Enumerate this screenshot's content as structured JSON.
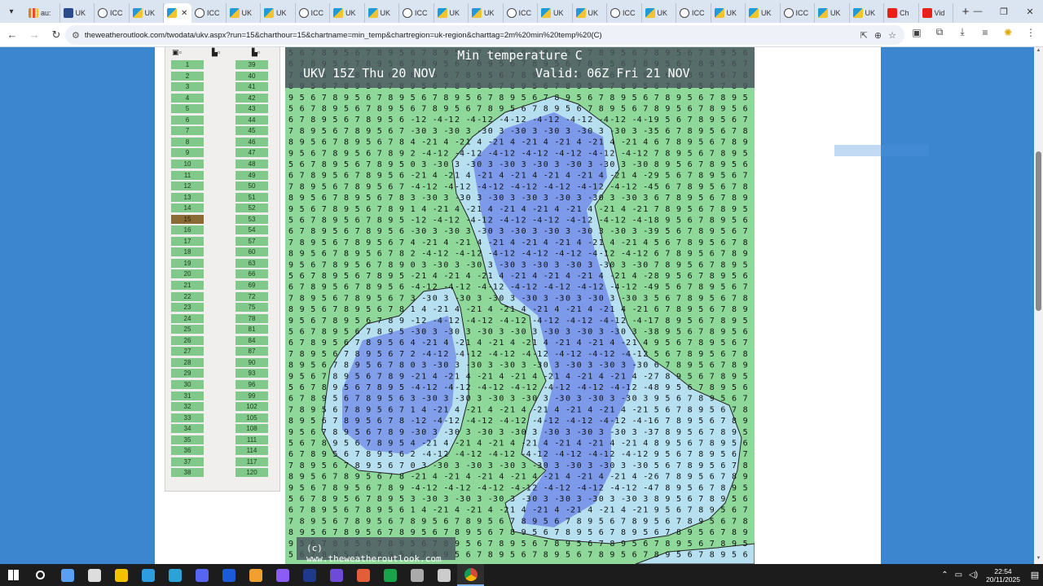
{
  "browser": {
    "tabs": [
      {
        "label": "au:",
        "icon": "bars-icon"
      },
      {
        "label": "UK",
        "icon": "flag-icon"
      },
      {
        "label": "ICC",
        "icon": "globe-icon"
      },
      {
        "label": "UK",
        "icon": "weather-icon"
      },
      {
        "label": "",
        "icon": "weather-icon",
        "active": true
      },
      {
        "label": "ICC",
        "icon": "globe-icon"
      },
      {
        "label": "UK",
        "icon": "weather-icon"
      },
      {
        "label": "UK",
        "icon": "weather-icon"
      },
      {
        "label": "ICC",
        "icon": "globe-icon"
      },
      {
        "label": "UK",
        "icon": "weather-icon"
      },
      {
        "label": "UK",
        "icon": "weather-icon"
      },
      {
        "label": "ICC",
        "icon": "globe-icon"
      },
      {
        "label": "UK",
        "icon": "weather-icon"
      },
      {
        "label": "UK",
        "icon": "weather-icon"
      },
      {
        "label": "ICC",
        "icon": "globe-icon"
      },
      {
        "label": "UK",
        "icon": "weather-icon"
      },
      {
        "label": "UK",
        "icon": "weather-icon"
      },
      {
        "label": "ICC",
        "icon": "globe-icon"
      },
      {
        "label": "UK",
        "icon": "weather-icon"
      },
      {
        "label": "ICC",
        "icon": "globe-icon"
      },
      {
        "label": "UK",
        "icon": "weather-icon"
      },
      {
        "label": "UK",
        "icon": "weather-icon"
      },
      {
        "label": "ICC",
        "icon": "globe-icon"
      },
      {
        "label": "UK",
        "icon": "weather-icon"
      },
      {
        "label": "UK",
        "icon": "weather-icon"
      },
      {
        "label": "Ch",
        "icon": "youtube-icon"
      },
      {
        "label": "Vid",
        "icon": "youtube-icon"
      }
    ],
    "url": "theweatheroutlook.com/twodata/ukv.aspx?run=15&charthour=15&chartname=min_temp&chartregion=uk-region&charttag=2m%20min%20temp%20(C)"
  },
  "hours": {
    "col1": [
      "1",
      "2",
      "3",
      "4",
      "5",
      "6",
      "7",
      "8",
      "9",
      "10",
      "11",
      "12",
      "13",
      "14",
      "15",
      "16",
      "17",
      "18",
      "19",
      "20",
      "21",
      "22",
      "23",
      "24",
      "25",
      "26",
      "27",
      "28",
      "29",
      "30",
      "31",
      "32",
      "33",
      "34",
      "35",
      "36",
      "37",
      "38"
    ],
    "col2": [
      "39",
      "40",
      "41",
      "42",
      "43",
      "44",
      "45",
      "46",
      "47",
      "48",
      "49",
      "50",
      "51",
      "52",
      "53",
      "54",
      "57",
      "60",
      "63",
      "66",
      "69",
      "72",
      "75",
      "78",
      "81",
      "84",
      "87",
      "90",
      "93",
      "96",
      "99",
      "102",
      "105",
      "108",
      "111",
      "114",
      "117",
      "120"
    ],
    "selected": "15"
  },
  "map": {
    "title": "Min temperature C",
    "run": "UKV 15Z Thu 20 NOV",
    "valid": "Valid: 06Z Fri 21 NOV",
    "copyright": "(c) www.theweatheroutlook.com"
  },
  "colors": {
    "sea_green": "#8ed99a",
    "land_light_blue": "#b6e0f0",
    "land_blue": "#6f88e8",
    "page_background": "#3b86cf",
    "selected_hour": "#8b6b35"
  },
  "taskbar": {
    "time": "22:54",
    "date": "20/11/2025",
    "apps": [
      "windows-start-icon",
      "search-icon",
      "copilot-icon",
      "files-icon",
      "folder-icon",
      "edge-icon",
      "telegram-icon",
      "discord-icon",
      "malwarebytes-icon",
      "photos-icon",
      "media-icon",
      "photoshop-icon",
      "obs-icon",
      "draw-icon",
      "capture-icon",
      "game-icon",
      "settings-icon",
      "chrome-icon"
    ]
  }
}
